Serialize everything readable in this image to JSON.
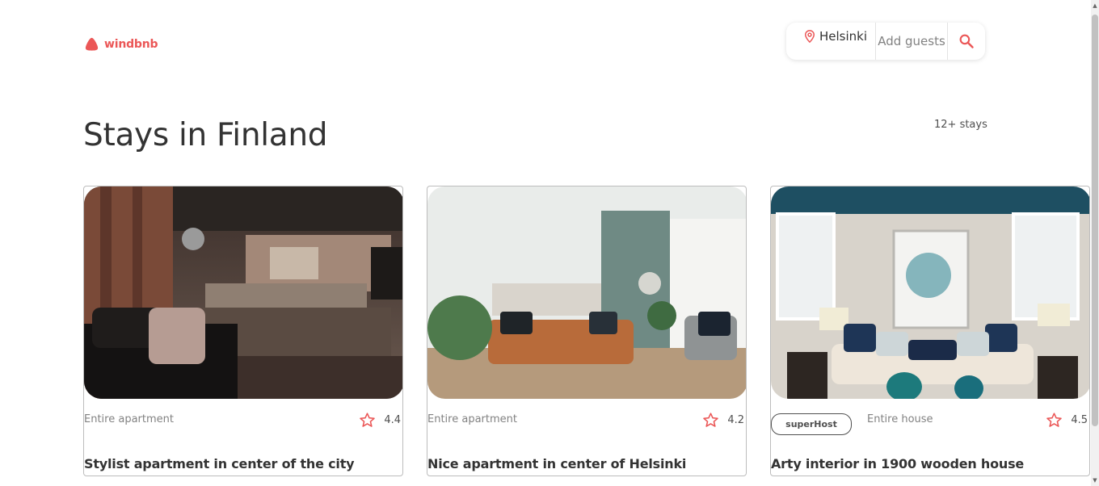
{
  "brand": {
    "name": "windbnb",
    "color": "#eb5757"
  },
  "search": {
    "location": "Helsinki",
    "guests_placeholder": "Add guests",
    "location_icon": "map-pin-icon",
    "search_icon": "search-icon"
  },
  "main": {
    "title": "Stays in Finland",
    "count": "12+ stays"
  },
  "stays": [
    {
      "type": "Entire apartment",
      "rating": "4.4",
      "title": "Stylist apartment in center of the city",
      "superhost": false
    },
    {
      "type": "Entire apartment",
      "rating": "4.2",
      "title": "Nice apartment in center of Helsinki",
      "superhost": false
    },
    {
      "type": "Entire house",
      "rating": "4.5",
      "title": "Arty interior in 1900 wooden house",
      "superhost": true,
      "badge": "superHost"
    }
  ]
}
